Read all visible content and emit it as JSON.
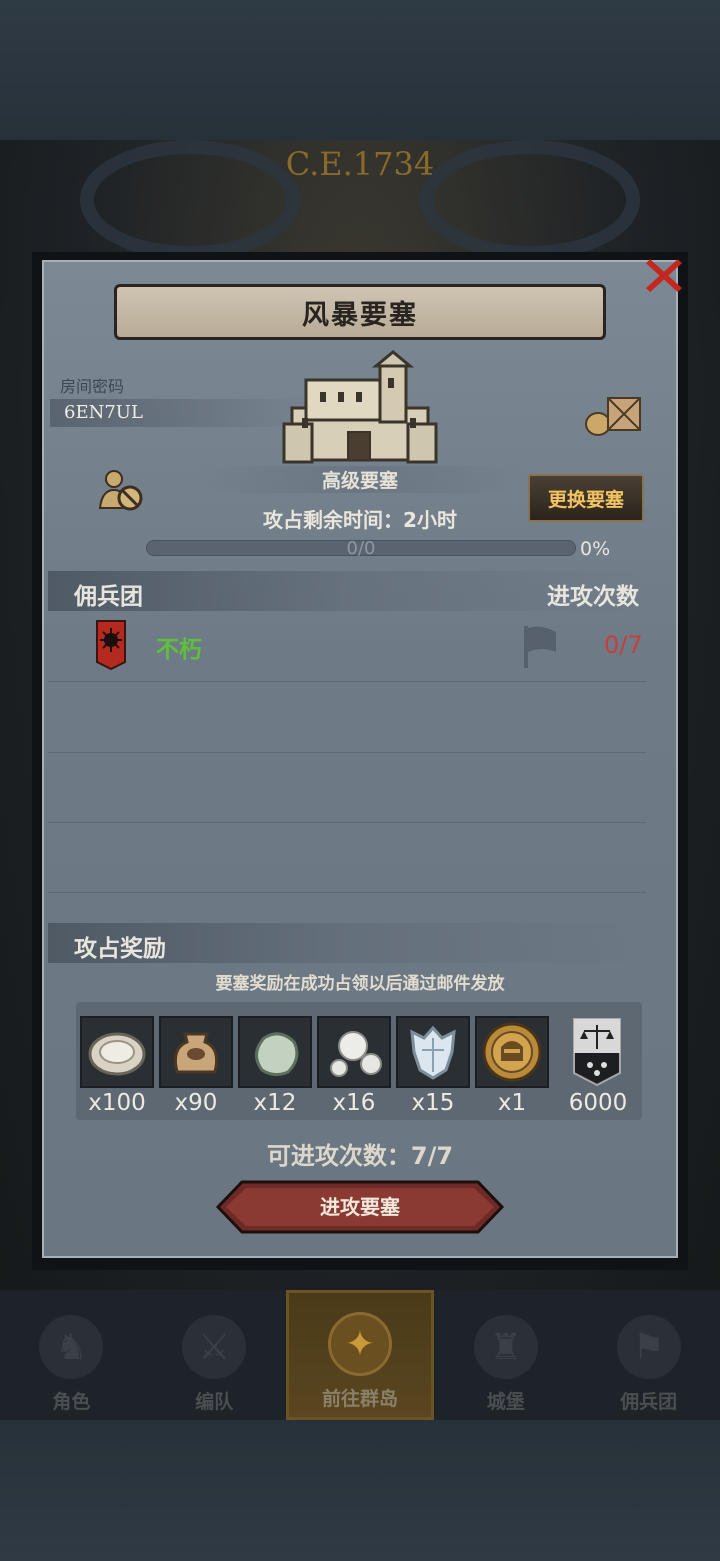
{
  "header": {
    "year": "C.E.1734"
  },
  "dialog": {
    "title": "风暴要塞",
    "close_icon": "close-x-icon",
    "room_label": "房间密码",
    "room_code": "6EN7UL",
    "fortress_level": "高级要塞",
    "change_button": "更换要塞",
    "time_left": "攻占剩余时间：2小时",
    "progress": {
      "text": "0/0",
      "percent_label": "0%",
      "value": 0
    },
    "mercenary_header": "佣兵团",
    "attacks_header": "进攻次数",
    "mercenaries": [
      {
        "name": "不朽",
        "attacks": "0/7",
        "name_color": "#5ec13c",
        "attacks_color": "#c4403a"
      }
    ],
    "rewards_header": "攻占奖励",
    "reward_note": "要塞奖励在成功占领以后通过邮件发放",
    "rewards": [
      {
        "icon": "oyster-icon",
        "count": "x100"
      },
      {
        "icon": "sack-icon",
        "count": "x90"
      },
      {
        "icon": "jade-stone-icon",
        "count": "x12"
      },
      {
        "icon": "pearl-icon",
        "count": "x16"
      },
      {
        "icon": "crystal-icon",
        "count": "x15"
      },
      {
        "icon": "knight-medal-icon",
        "count": "x1"
      },
      {
        "icon": "justice-banner-icon",
        "count": "6000"
      }
    ],
    "attempts": "可进攻次数：7/7",
    "attack_button": "进攻要塞"
  },
  "nav": {
    "items": [
      {
        "label": "角色",
        "icon": "character-icon",
        "active": false
      },
      {
        "label": "编队",
        "icon": "formation-icon",
        "active": false
      },
      {
        "label": "前往群岛",
        "icon": "islands-icon",
        "active": true
      },
      {
        "label": "城堡",
        "icon": "castle-icon",
        "active": false
      },
      {
        "label": "佣兵团",
        "icon": "mercenary-icon",
        "active": false
      }
    ]
  }
}
